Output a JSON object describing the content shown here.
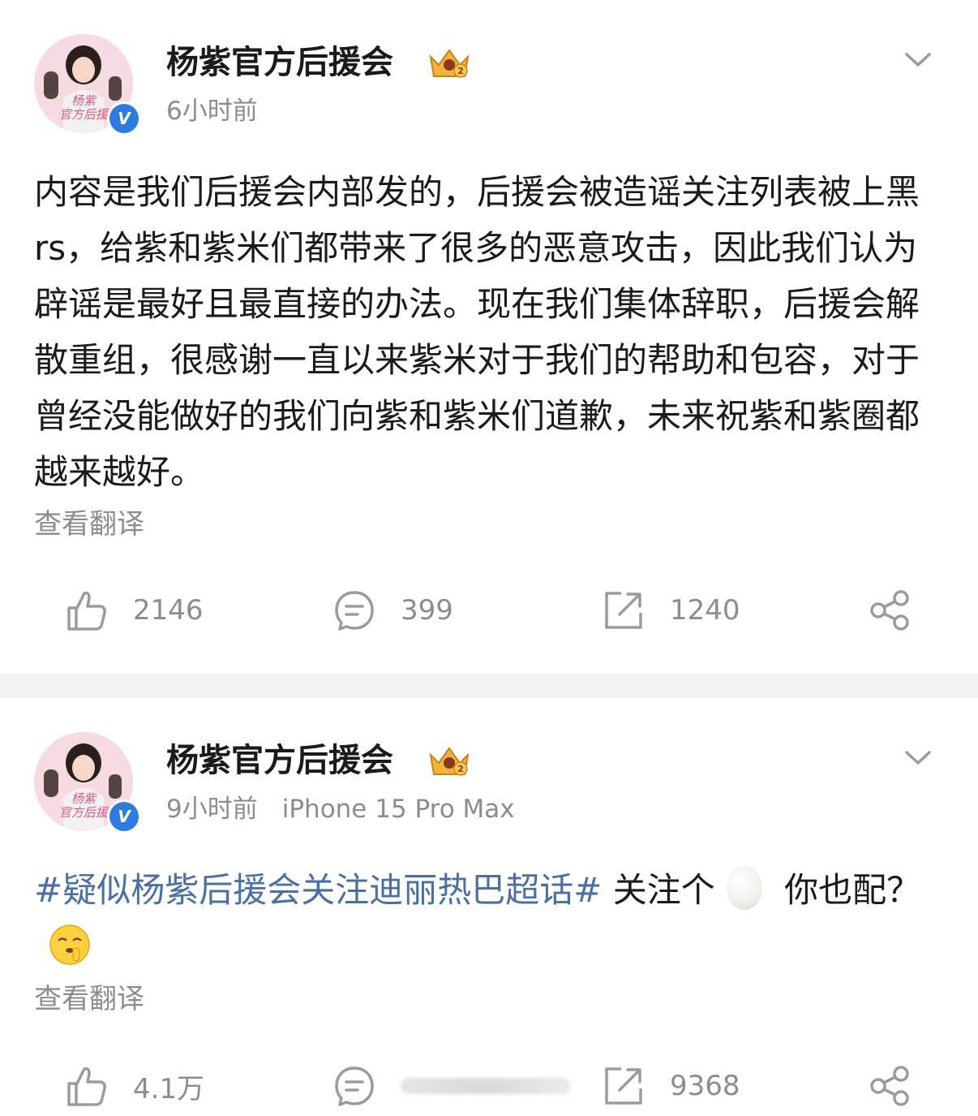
{
  "posts": [
    {
      "author": "杨紫官方后援会",
      "avatar_caption": "杨紫\n官方后援",
      "time": "6小时前",
      "device": "",
      "content": "内容是我们后援会内部发的，后援会被造谣关注列表被上黑rs，给紫和紫米们都带来了很多的恶意攻击，因此我们认为辟谣是最好且最直接的办法。现在我们集体辞职，后援会解散重组，很感谢一直以来紫米对于我们的帮助和包容，对于曾经没能做好的我们向紫和紫米们道歉，未来祝紫和紫圈都越来越好。",
      "translate_label": "查看翻译",
      "likes": "2146",
      "comments": "399",
      "reposts": "1240"
    },
    {
      "author": "杨紫官方后援会",
      "avatar_caption": "杨紫\n官方后援",
      "time": "9小时前",
      "device": "iPhone 15 Pro Max",
      "hashtag": "#疑似杨紫后援会关注迪丽热巴超话#",
      "text_a": " 关注个",
      "text_b": " 你也配？",
      "translate_label": "查看翻译",
      "likes": "4.1万",
      "comments": "",
      "reposts": "9368"
    }
  ],
  "colors": {
    "hashtag": "#4a6fa5",
    "verified": "#2d7de1",
    "meta": "#8c8c8c",
    "divider": "#f2f2f2"
  },
  "icons": [
    "verified-icon",
    "crown-badge-icon",
    "chevron-down-icon",
    "like-icon",
    "comment-icon",
    "repost-icon",
    "share-icon",
    "egg-emoji-icon",
    "shush-emoji-icon"
  ]
}
